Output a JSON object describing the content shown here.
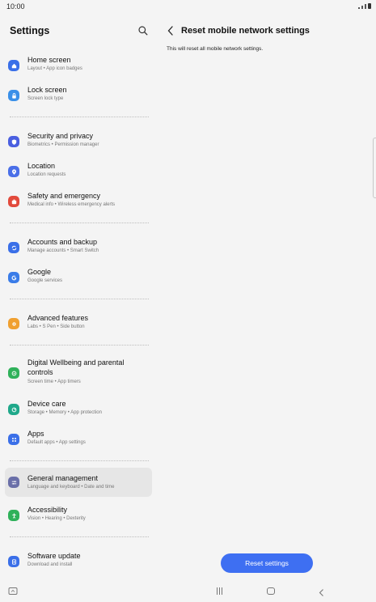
{
  "status": {
    "time": "10:00"
  },
  "left": {
    "title": "Settings",
    "items": [
      {
        "title": "Home screen",
        "subtitle": "Layout • App icon badges",
        "icon": "home-icon",
        "color": "#3a6fe8"
      },
      {
        "title": "Lock screen",
        "subtitle": "Screen lock type",
        "icon": "lock-icon",
        "color": "#3a8fe8"
      },
      {
        "title": "Security and privacy",
        "subtitle": "Biometrics • Permission manager",
        "icon": "shield-icon",
        "color": "#4a5fe0"
      },
      {
        "title": "Location",
        "subtitle": "Location requests",
        "icon": "location-pin-icon",
        "color": "#4a6fe8"
      },
      {
        "title": "Safety and emergency",
        "subtitle": "Medical info • Wireless emergency alerts",
        "icon": "emergency-icon",
        "color": "#e24a3c"
      },
      {
        "title": "Accounts and backup",
        "subtitle": "Manage accounts • Smart Switch",
        "icon": "sync-icon",
        "color": "#3a6fe8"
      },
      {
        "title": "Google",
        "subtitle": "Google services",
        "icon": "google-icon",
        "color": "#3a7ce8"
      },
      {
        "title": "Advanced features",
        "subtitle": "Labs • S Pen • Side button",
        "icon": "gear-plus-icon",
        "color": "#f0a030"
      },
      {
        "title": "Digital Wellbeing and parental",
        "title2": "controls",
        "subtitle": "Screen time • App timers",
        "icon": "wellbeing-icon",
        "color": "#2fb15a"
      },
      {
        "title": "Device care",
        "subtitle": "Storage • Memory • App protection",
        "icon": "device-care-icon",
        "color": "#1fa88a"
      },
      {
        "title": "Apps",
        "subtitle": "Default apps • App settings",
        "icon": "apps-icon",
        "color": "#3a6fe8"
      },
      {
        "title": "General management",
        "subtitle": "Language and keyboard • Date and time",
        "icon": "sliders-icon",
        "color": "#6a6fa8"
      },
      {
        "title": "Accessibility",
        "subtitle": "Vision • Hearing • Dexterity",
        "icon": "accessibility-icon",
        "color": "#2fb15a"
      },
      {
        "title": "Software update",
        "subtitle": "Download and install",
        "icon": "software-update-icon",
        "color": "#3a6fe8"
      }
    ]
  },
  "right": {
    "title": "Reset mobile network settings",
    "description": "This will reset all mobile network settings.",
    "button_label": "Reset settings",
    "accent": "#3e6ff2"
  }
}
